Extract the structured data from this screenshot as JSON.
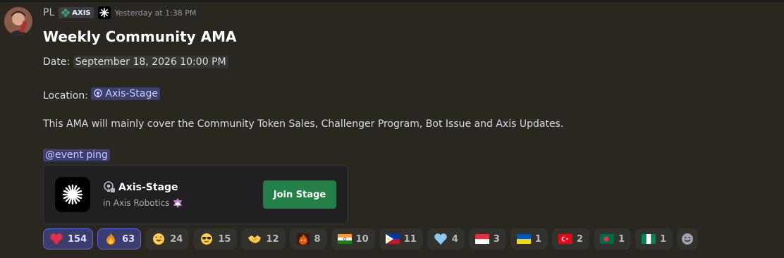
{
  "message": {
    "author": "PL",
    "server_tag": "AXIS",
    "timestamp": "Yesterday at 1:38 PM",
    "title": "Weekly Community AMA",
    "date_label": "Date:",
    "date_value": "September 18, 2026 10:00 PM",
    "location_label": "Location:",
    "location_channel": "Axis-Stage",
    "body": "This AMA will mainly cover the Community Token Sales, Challenger Program, Bot Issue and Axis Updates.",
    "ping": "@event ping"
  },
  "event_card": {
    "channel": "Axis-Stage",
    "server_prefix": "in Axis Robotics",
    "button": "Join Stage"
  },
  "reactions": [
    {
      "icon": "red-heart-icon",
      "count": "154",
      "active": true
    },
    {
      "icon": "fire-icon",
      "count": "63",
      "active": true
    },
    {
      "icon": "grinning-face-icon",
      "count": "24",
      "active": false
    },
    {
      "icon": "sunglasses-face-icon",
      "count": "15",
      "active": false
    },
    {
      "icon": "handshake-icon",
      "count": "12",
      "active": false
    },
    {
      "icon": "fire-character-icon",
      "count": "8",
      "active": false
    },
    {
      "icon": "india-flag-icon",
      "count": "10",
      "active": false
    },
    {
      "icon": "philippines-flag-icon",
      "count": "11",
      "active": false
    },
    {
      "icon": "light-blue-heart-icon",
      "count": "4",
      "active": false
    },
    {
      "icon": "indonesia-flag-icon",
      "count": "3",
      "active": false
    },
    {
      "icon": "ukraine-flag-icon",
      "count": "1",
      "active": false
    },
    {
      "icon": "turkey-flag-icon",
      "count": "2",
      "active": false
    },
    {
      "icon": "bangladesh-flag-icon",
      "count": "1",
      "active": false
    },
    {
      "icon": "nigeria-flag-icon",
      "count": "1",
      "active": false
    }
  ],
  "colors": {
    "background": "#2a2620",
    "mention_bg": "#3c3f6e",
    "join_button": "#248046",
    "active_reaction_border": "#5865f2"
  }
}
